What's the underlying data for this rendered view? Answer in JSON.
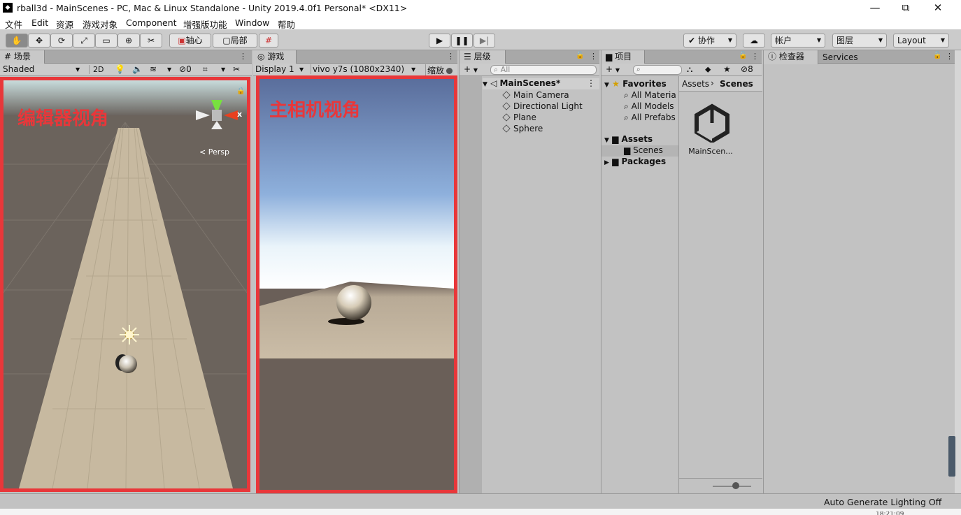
{
  "window": {
    "title": "rball3d - MainScenes - PC, Mac & Linux Standalone - Unity 2019.4.0f1 Personal* <DX11>",
    "app_icon": "unity-icon",
    "minimize": "—",
    "maximize": "⧉",
    "close": "✕"
  },
  "menu": [
    "文件",
    "Edit",
    "资源",
    "游戏对象",
    "Component",
    "增强版功能",
    "Window",
    "帮助"
  ],
  "toolbar": {
    "pivot_label": "轴心",
    "local_label": "局部",
    "collab_label": "协作",
    "account_label": "帐户",
    "layers_label": "图层",
    "layout_label": "Layout"
  },
  "scene": {
    "tab_label": "场景",
    "shading": "Shaded",
    "mode_2d": "2D",
    "hidden_count": "0",
    "overlay_label": "编辑器视角",
    "persp_label": "Persp",
    "gizmo_x": "x"
  },
  "game": {
    "tab_label": "游戏",
    "display": "Display 1",
    "resolution": "vivo y7s (1080x2340)",
    "scale_label": "缩放",
    "overlay_label": "主相机视角"
  },
  "hierarchy": {
    "tab_label": "层级",
    "search_placeholder": "All",
    "scene_name": "MainScenes*",
    "items": [
      "Main Camera",
      "Directional Light",
      "Plane",
      "Sphere"
    ]
  },
  "project": {
    "tab_label": "项目",
    "hidden_count": "8",
    "favorites_label": "Favorites",
    "favorites": [
      "All Materia",
      "All Models",
      "All Prefabs"
    ],
    "assets_label": "Assets",
    "scenes_label": "Scenes",
    "packages_label": "Packages",
    "breadcrumb_root": "Assets",
    "breadcrumb_current": "Scenes",
    "asset_name": "MainScen...",
    "thumbnail_size": 0.6
  },
  "inspector": {
    "tab_label": "检查器",
    "services_label": "Services"
  },
  "status": {
    "lighting": "Auto Generate Lighting Off",
    "clock": "18:21:09"
  }
}
